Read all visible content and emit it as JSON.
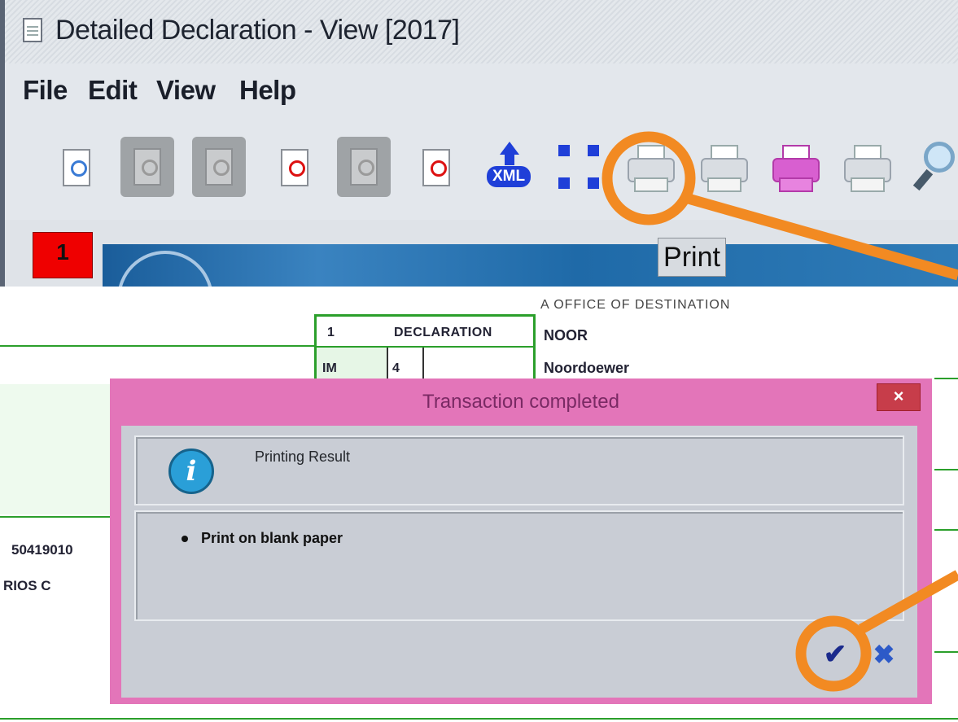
{
  "window": {
    "title": "Detailed Declaration - View [2017]"
  },
  "menu": {
    "file": "File",
    "edit": "Edit",
    "view": "View",
    "help": "Help"
  },
  "toolbar": {
    "xml_label": "XML",
    "print_tooltip": "Print"
  },
  "tabs": {
    "active_number": "1"
  },
  "form": {
    "destination_header": "A OFFICE OF DESTINATION",
    "declaration_number": "1",
    "declaration_label": "DECLARATION",
    "declaration_type": "IM",
    "declaration_subtype": "4",
    "destination_code": "NOOR",
    "destination_name": "Noordoewer",
    "left_code": "50419010",
    "left_name": "RIOS C"
  },
  "dialog": {
    "title": "Transaction completed",
    "close_label": "×",
    "info_title": "Printing Result",
    "message": "Print on blank paper",
    "ok_label": "✔",
    "cancel_label": "✖"
  },
  "colors": {
    "dialog_frame": "#e375b9",
    "callout": "#f28a22",
    "form_lines": "#2b9f2b",
    "tab_badge": "#ef0000"
  },
  "icons": [
    "search-doc-icon",
    "disabled-doc-icon",
    "disabled-doc-icon",
    "view-doc-icon",
    "disabled-doc-icon",
    "view-doc-icon",
    "xml-export-icon",
    "expand-icon",
    "printer-icon",
    "printer-icon",
    "printer-pink-icon",
    "printer-icon",
    "magnifier-icon"
  ]
}
